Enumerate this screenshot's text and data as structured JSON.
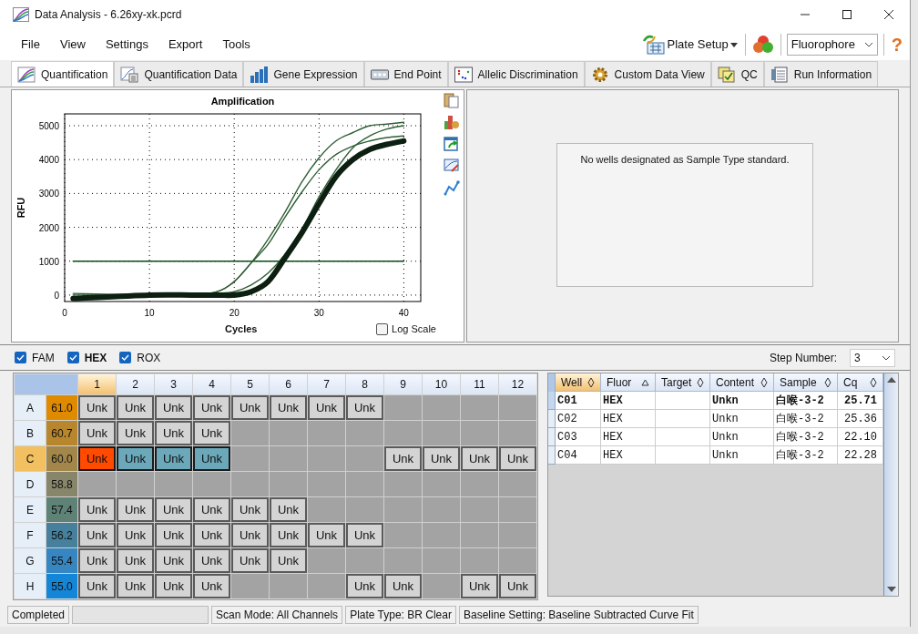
{
  "window": {
    "title": "Data Analysis - 6.26xy-xk.pcrd"
  },
  "menu": [
    "File",
    "View",
    "Settings",
    "Export",
    "Tools"
  ],
  "toolbar": {
    "plate_setup": "Plate Setup",
    "fluorophore": "Fluorophore",
    "help": "?"
  },
  "tabs": [
    {
      "kind": "amplification",
      "label": "Quantification",
      "selected": true
    },
    {
      "kind": "data",
      "label": "Quantification Data",
      "selected": false
    },
    {
      "kind": "bars",
      "label": "Gene Expression",
      "selected": false
    },
    {
      "kind": "endpoint",
      "label": "End Point",
      "selected": false
    },
    {
      "kind": "scatter",
      "label": "Allelic Discrimination",
      "selected": false
    },
    {
      "kind": "gear",
      "label": "Custom Data View",
      "selected": false
    },
    {
      "kind": "qc",
      "label": "QC",
      "selected": false
    },
    {
      "kind": "info",
      "label": "Run Information",
      "selected": false
    }
  ],
  "chart": {
    "log_scale": {
      "label": "Log Scale",
      "checked": false
    },
    "chart_data": {
      "type": "line",
      "title": "Amplification",
      "xlabel": "Cycles",
      "ylabel": "RFU",
      "x": [
        1,
        10,
        15,
        18,
        20,
        22,
        24,
        26,
        28,
        30,
        32,
        34,
        36,
        38,
        40
      ],
      "xlim": [
        0,
        42
      ],
      "ylim": [
        -190,
        5350
      ],
      "xticks": [
        0,
        10,
        20,
        30,
        40
      ],
      "yticks": [
        0,
        1000,
        2000,
        3000,
        4000,
        5000
      ],
      "grid": true,
      "series": [
        {
          "color": "#0d1f10",
          "values": [
            -100,
            0,
            0,
            0,
            0,
            100,
            400,
            1100,
            1850,
            2700,
            3500,
            4000,
            4300,
            4450,
            4550
          ]
        },
        {
          "color": "#2e5e34",
          "values": [
            50,
            0,
            0,
            50,
            100,
            300,
            650,
            1200,
            1950,
            2900,
            3700,
            4350,
            4700,
            4900,
            5000
          ]
        },
        {
          "color": "#2e5e34",
          "values": [
            0,
            0,
            0,
            100,
            400,
            950,
            1650,
            2450,
            3350,
            4050,
            4550,
            4800,
            5000,
            5050,
            5100
          ]
        },
        {
          "color": "#2e5e34",
          "values": [
            -50,
            0,
            0,
            100,
            400,
            950,
            1500,
            2300,
            3050,
            3700,
            4150,
            4400,
            4550,
            4650,
            4700
          ]
        },
        {
          "color": "#0b4a12",
          "values": [
            1000,
            1000,
            1000,
            1000,
            1000,
            1000,
            1000,
            1000,
            1000,
            1000,
            1000,
            1000,
            1000,
            1000,
            1000
          ]
        }
      ]
    }
  },
  "standard_panel": {
    "message": "No wells designated as Sample Type standard."
  },
  "fluors": [
    {
      "label": "FAM",
      "checked": true,
      "selected": false
    },
    {
      "label": "HEX",
      "checked": true,
      "selected": true
    },
    {
      "label": "ROX",
      "checked": true,
      "selected": false
    }
  ],
  "step": {
    "label": "Step Number:",
    "value": "3"
  },
  "plate": {
    "columns": [
      {
        "label": "1",
        "selected": true
      },
      {
        "label": "2",
        "selected": false
      },
      {
        "label": "3",
        "selected": false
      },
      {
        "label": "4",
        "selected": false
      },
      {
        "label": "5",
        "selected": false
      },
      {
        "label": "6",
        "selected": false
      },
      {
        "label": "7",
        "selected": false
      },
      {
        "label": "8",
        "selected": false
      },
      {
        "label": "9",
        "selected": false
      },
      {
        "label": "10",
        "selected": false
      },
      {
        "label": "11",
        "selected": false
      },
      {
        "label": "12",
        "selected": false
      }
    ],
    "rows": [
      {
        "label": "A",
        "temp": "61.0",
        "color": "#e08a00",
        "selected": false,
        "wells": [
          {
            "kind": "sample",
            "label": "Unk",
            "selected": false,
            "current": false
          },
          {
            "kind": "sample",
            "label": "Unk",
            "selected": false,
            "current": false
          },
          {
            "kind": "sample",
            "label": "Unk",
            "selected": false,
            "current": false
          },
          {
            "kind": "sample",
            "label": "Unk",
            "selected": false,
            "current": false
          },
          {
            "kind": "sample",
            "label": "Unk",
            "selected": false,
            "current": false
          },
          {
            "kind": "sample",
            "label": "Unk",
            "selected": false,
            "current": false
          },
          {
            "kind": "sample",
            "label": "Unk",
            "selected": false,
            "current": false
          },
          {
            "kind": "sample",
            "label": "Unk",
            "selected": false,
            "current": false
          },
          {
            "kind": "empty"
          },
          {
            "kind": "empty"
          },
          {
            "kind": "empty"
          },
          {
            "kind": "empty"
          }
        ]
      },
      {
        "label": "B",
        "temp": "60.7",
        "color": "#b8862c",
        "selected": false,
        "wells": [
          {
            "kind": "sample",
            "label": "Unk",
            "selected": false,
            "current": false
          },
          {
            "kind": "sample",
            "label": "Unk",
            "selected": false,
            "current": false
          },
          {
            "kind": "sample",
            "label": "Unk",
            "selected": false,
            "current": false
          },
          {
            "kind": "sample",
            "label": "Unk",
            "selected": false,
            "current": false
          },
          {
            "kind": "empty"
          },
          {
            "kind": "empty"
          },
          {
            "kind": "empty"
          },
          {
            "kind": "empty"
          },
          {
            "kind": "empty"
          },
          {
            "kind": "empty"
          },
          {
            "kind": "empty"
          },
          {
            "kind": "empty"
          }
        ]
      },
      {
        "label": "C",
        "temp": "60.0",
        "color": "#a2864a",
        "selected": true,
        "wells": [
          {
            "kind": "sample",
            "label": "Unk",
            "selected": true,
            "current": true
          },
          {
            "kind": "sample",
            "label": "Unk",
            "selected": true,
            "current": false
          },
          {
            "kind": "sample",
            "label": "Unk",
            "selected": true,
            "current": false
          },
          {
            "kind": "sample",
            "label": "Unk",
            "selected": true,
            "current": false
          },
          {
            "kind": "empty"
          },
          {
            "kind": "empty"
          },
          {
            "kind": "empty"
          },
          {
            "kind": "empty"
          },
          {
            "kind": "sample",
            "label": "Unk",
            "selected": false,
            "current": false
          },
          {
            "kind": "sample",
            "label": "Unk",
            "selected": false,
            "current": false
          },
          {
            "kind": "sample",
            "label": "Unk",
            "selected": false,
            "current": false
          },
          {
            "kind": "sample",
            "label": "Unk",
            "selected": false,
            "current": false
          }
        ]
      },
      {
        "label": "D",
        "temp": "58.8",
        "color": "#88866a",
        "selected": false,
        "wells": [
          {
            "kind": "empty"
          },
          {
            "kind": "empty"
          },
          {
            "kind": "empty"
          },
          {
            "kind": "empty"
          },
          {
            "kind": "empty"
          },
          {
            "kind": "empty"
          },
          {
            "kind": "empty"
          },
          {
            "kind": "empty"
          },
          {
            "kind": "empty"
          },
          {
            "kind": "empty"
          },
          {
            "kind": "empty"
          },
          {
            "kind": "empty"
          }
        ]
      },
      {
        "label": "E",
        "temp": "57.4",
        "color": "#5e8276",
        "selected": false,
        "wells": [
          {
            "kind": "sample",
            "label": "Unk",
            "selected": false,
            "current": false
          },
          {
            "kind": "sample",
            "label": "Unk",
            "selected": false,
            "current": false
          },
          {
            "kind": "sample",
            "label": "Unk",
            "selected": false,
            "current": false
          },
          {
            "kind": "sample",
            "label": "Unk",
            "selected": false,
            "current": false
          },
          {
            "kind": "sample",
            "label": "Unk",
            "selected": false,
            "current": false
          },
          {
            "kind": "sample",
            "label": "Unk",
            "selected": false,
            "current": false
          },
          {
            "kind": "empty"
          },
          {
            "kind": "empty"
          },
          {
            "kind": "empty"
          },
          {
            "kind": "empty"
          },
          {
            "kind": "empty"
          },
          {
            "kind": "empty"
          }
        ]
      },
      {
        "label": "F",
        "temp": "56.2",
        "color": "#46809c",
        "selected": false,
        "wells": [
          {
            "kind": "sample",
            "label": "Unk",
            "selected": false,
            "current": false
          },
          {
            "kind": "sample",
            "label": "Unk",
            "selected": false,
            "current": false
          },
          {
            "kind": "sample",
            "label": "Unk",
            "selected": false,
            "current": false
          },
          {
            "kind": "sample",
            "label": "Unk",
            "selected": false,
            "current": false
          },
          {
            "kind": "sample",
            "label": "Unk",
            "selected": false,
            "current": false
          },
          {
            "kind": "sample",
            "label": "Unk",
            "selected": false,
            "current": false
          },
          {
            "kind": "sample",
            "label": "Unk",
            "selected": false,
            "current": false
          },
          {
            "kind": "sample",
            "label": "Unk",
            "selected": false,
            "current": false
          },
          {
            "kind": "empty"
          },
          {
            "kind": "empty"
          },
          {
            "kind": "empty"
          },
          {
            "kind": "empty"
          }
        ]
      },
      {
        "label": "G",
        "temp": "55.4",
        "color": "#3686c2",
        "selected": false,
        "wells": [
          {
            "kind": "sample",
            "label": "Unk",
            "selected": false,
            "current": false
          },
          {
            "kind": "sample",
            "label": "Unk",
            "selected": false,
            "current": false
          },
          {
            "kind": "sample",
            "label": "Unk",
            "selected": false,
            "current": false
          },
          {
            "kind": "sample",
            "label": "Unk",
            "selected": false,
            "current": false
          },
          {
            "kind": "sample",
            "label": "Unk",
            "selected": false,
            "current": false
          },
          {
            "kind": "sample",
            "label": "Unk",
            "selected": false,
            "current": false
          },
          {
            "kind": "empty"
          },
          {
            "kind": "empty"
          },
          {
            "kind": "empty"
          },
          {
            "kind": "empty"
          },
          {
            "kind": "empty"
          },
          {
            "kind": "empty"
          }
        ]
      },
      {
        "label": "H",
        "temp": "55.0",
        "color": "#1486d8",
        "selected": false,
        "wells": [
          {
            "kind": "sample",
            "label": "Unk",
            "selected": false,
            "current": false
          },
          {
            "kind": "sample",
            "label": "Unk",
            "selected": false,
            "current": false
          },
          {
            "kind": "sample",
            "label": "Unk",
            "selected": false,
            "current": false
          },
          {
            "kind": "sample",
            "label": "Unk",
            "selected": false,
            "current": false
          },
          {
            "kind": "empty"
          },
          {
            "kind": "empty"
          },
          {
            "kind": "empty"
          },
          {
            "kind": "sample",
            "label": "Unk",
            "selected": false,
            "current": false
          },
          {
            "kind": "sample",
            "label": "Unk",
            "selected": false,
            "current": false
          },
          {
            "kind": "empty"
          },
          {
            "kind": "sample",
            "label": "Unk",
            "selected": false,
            "current": false
          },
          {
            "kind": "sample",
            "label": "Unk",
            "selected": false,
            "current": false
          }
        ]
      }
    ]
  },
  "table": {
    "columns": [
      {
        "label": "Well",
        "selected": true,
        "sorted": false
      },
      {
        "label": "Fluor",
        "selected": false,
        "sorted": true
      },
      {
        "label": "Target",
        "selected": false,
        "sorted": false
      },
      {
        "label": "Content",
        "selected": false,
        "sorted": false
      },
      {
        "label": "Sample",
        "selected": false,
        "sorted": false
      },
      {
        "label": "Cq",
        "selected": false,
        "sorted": false
      }
    ],
    "rows": [
      {
        "selected": true,
        "well": "C01",
        "fluor": "HEX",
        "content": "Unkn",
        "sample": "白喉-3-2",
        "cq": "25.71"
      },
      {
        "selected": false,
        "well": "C02",
        "fluor": "HEX",
        "content": "Unkn",
        "sample": "白喉-3-2",
        "cq": "25.36"
      },
      {
        "selected": false,
        "well": "C03",
        "fluor": "HEX",
        "content": "Unkn",
        "sample": "白喉-3-2",
        "cq": "22.10"
      },
      {
        "selected": false,
        "well": "C04",
        "fluor": "HEX",
        "content": "Unkn",
        "sample": "白喉-3-2",
        "cq": "22.28"
      }
    ]
  },
  "status_bar": [
    "Completed",
    "Scan Mode: All Channels",
    "Plate Type: BR Clear",
    "Baseline Setting: Baseline Subtracted Curve Fit"
  ]
}
